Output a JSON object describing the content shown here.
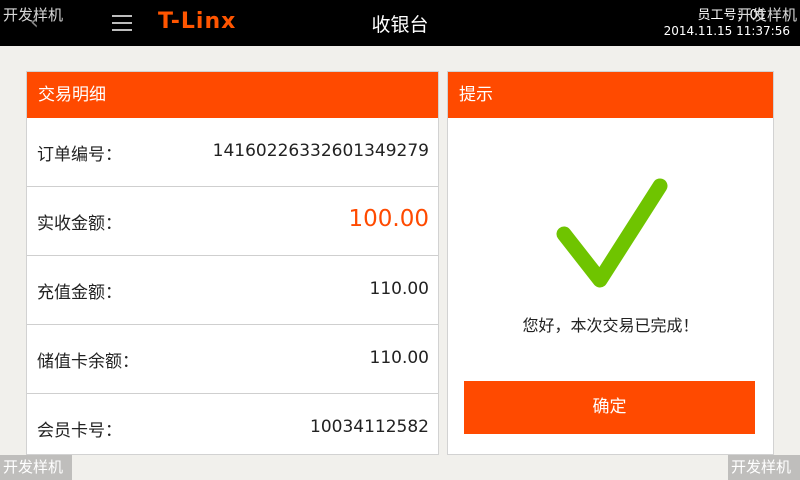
{
  "header": {
    "brand": "T-Linx",
    "title": "收银台",
    "employee_label": "员工号：01",
    "datetime": "2014.11.15 11:37:56"
  },
  "watermark": "开发样机",
  "details": {
    "header": "交易明细",
    "rows": [
      {
        "label": "订单编号：",
        "value": "14160226332601349279"
      },
      {
        "label": "实收金额：",
        "value": "100.00"
      },
      {
        "label": "充值金额：",
        "value": "110.00"
      },
      {
        "label": "储值卡余额：",
        "value": "110.00"
      },
      {
        "label": "会员卡号：",
        "value": "10034112582"
      }
    ]
  },
  "prompt": {
    "header": "提示",
    "message": "您好，本次交易已完成！",
    "confirm_label": "确定"
  },
  "colors": {
    "accent": "#ff4a00",
    "check": "#6fc400",
    "topbar": "#000000"
  },
  "icons": {
    "back": "back-arrow-icon",
    "menu": "hamburger-menu-icon",
    "check": "checkmark-icon"
  }
}
